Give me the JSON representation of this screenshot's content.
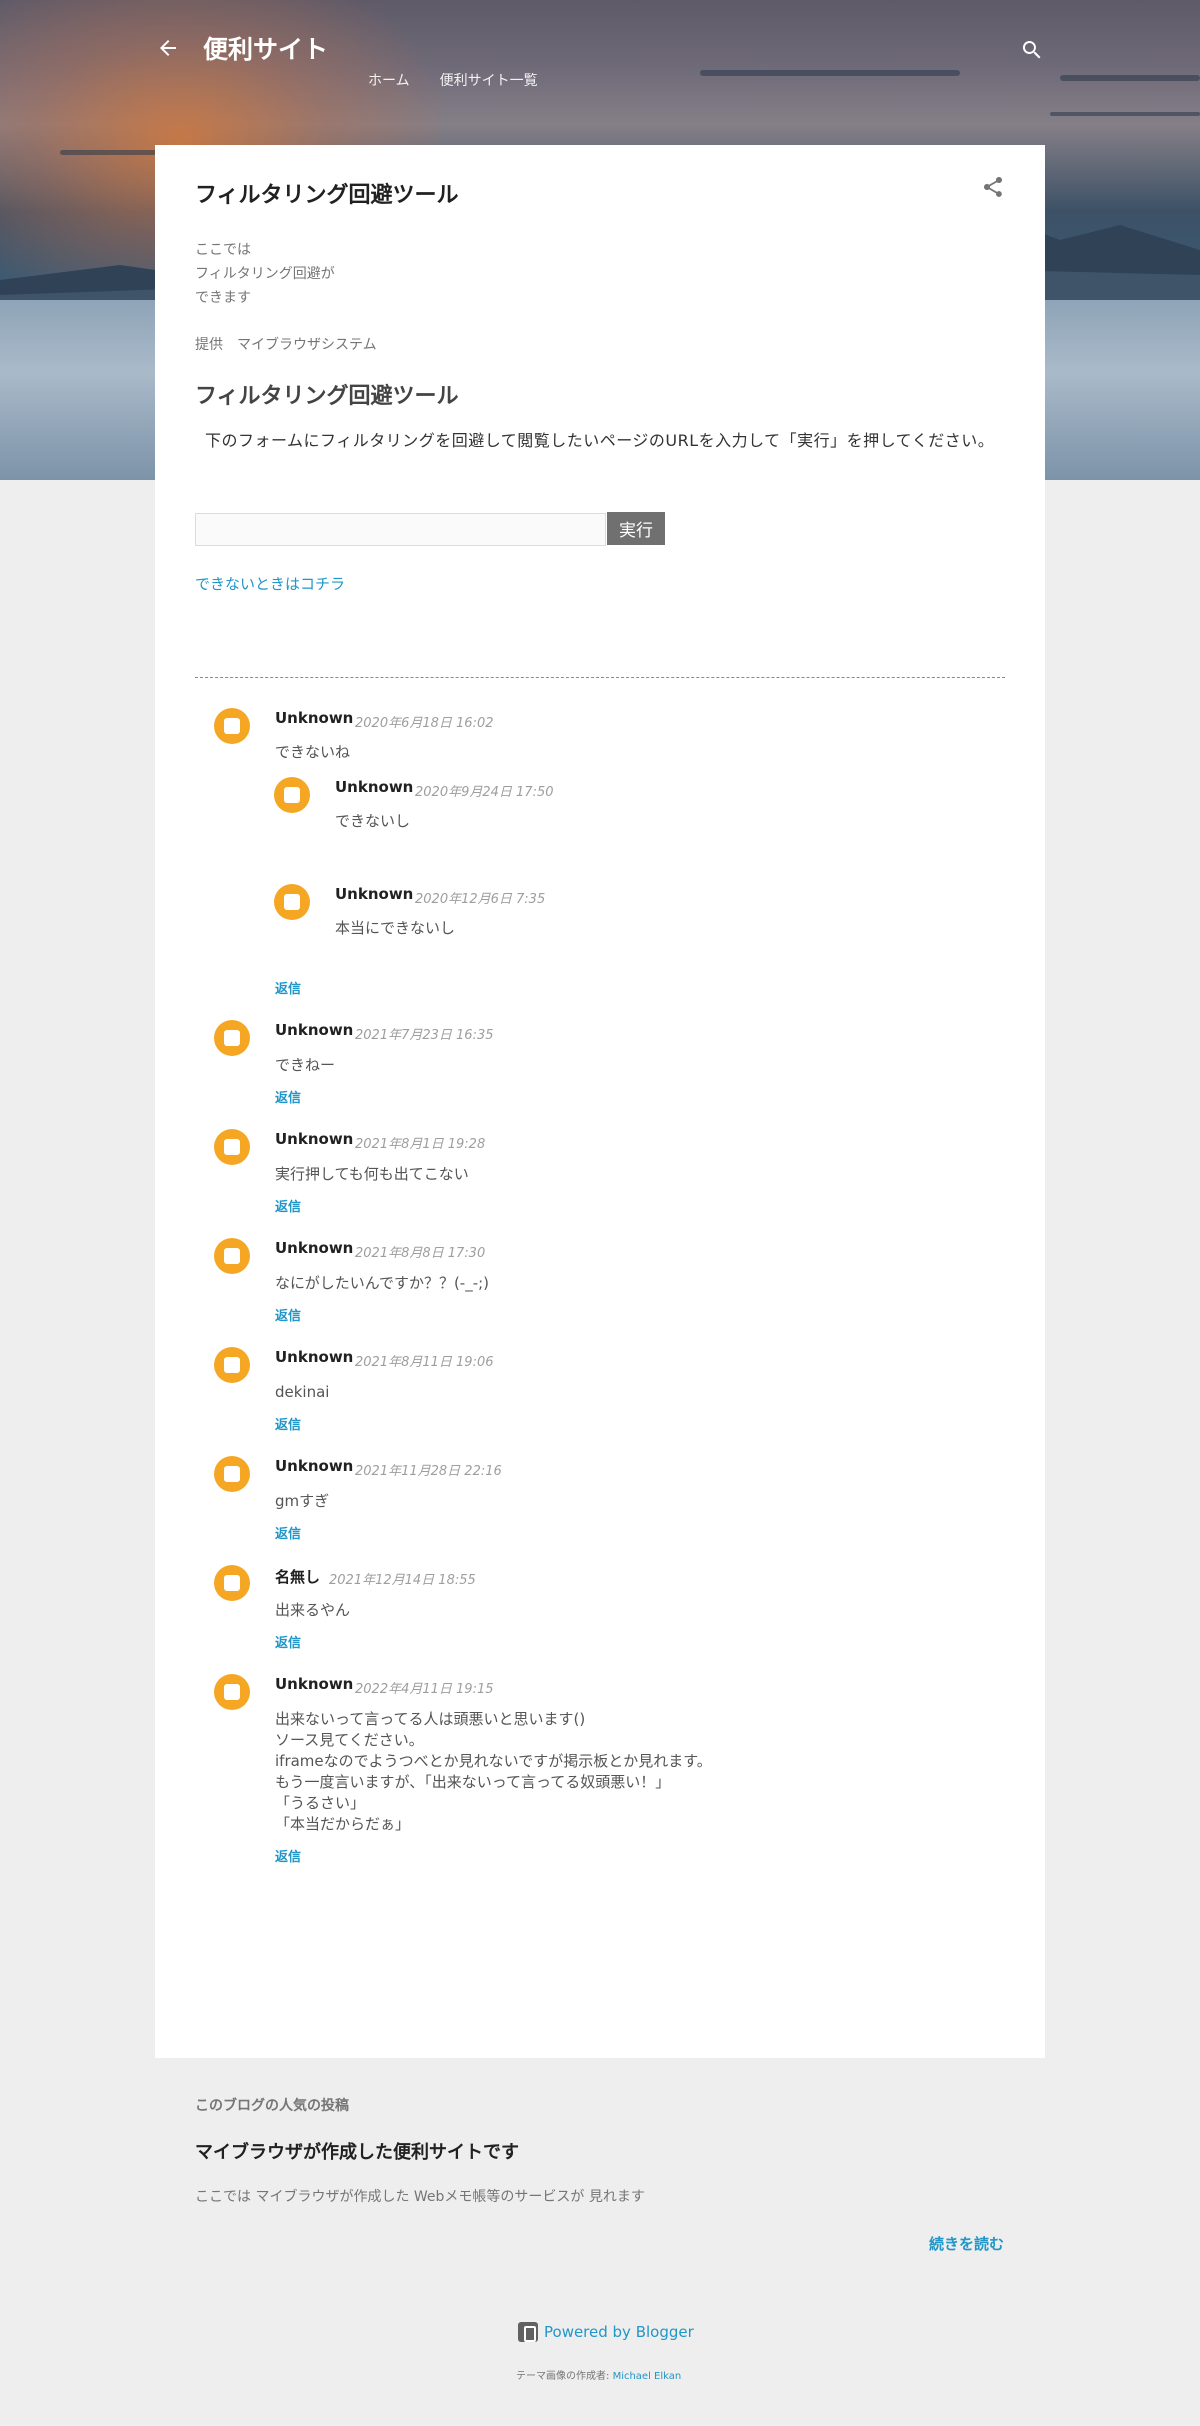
{
  "header": {
    "site_title": "便利サイト",
    "nav": [
      "ホーム",
      "便利サイト一覧"
    ]
  },
  "post": {
    "title": "フィルタリング回避ツール",
    "intro": [
      "ここでは",
      "フィルタリング回避が",
      "できます"
    ],
    "provider": "提供　マイブラウザシステム",
    "tool_heading": "フィルタリング回避ツール",
    "instruction": "下のフォームにフィルタリングを回避して閲覧したいページのURLを入力して「実行」を押してください。",
    "url_input_value": "",
    "run_label": "実行",
    "fallback_link": "できないときはコチラ"
  },
  "comments": [
    {
      "author": "Unknown",
      "date": "2020年6月18日 16:02",
      "body": [
        "できないね"
      ],
      "replies": [
        {
          "author": "Unknown",
          "date": "2020年9月24日 17:50",
          "body": [
            "できないし"
          ]
        },
        {
          "author": "Unknown",
          "date": "2020年12月6日 7:35",
          "body": [
            "本当にできないし"
          ]
        }
      ],
      "reply_label": "返信"
    },
    {
      "author": "Unknown",
      "date": "2021年7月23日 16:35",
      "body": [
        "できねー"
      ],
      "reply_label": "返信"
    },
    {
      "author": "Unknown",
      "date": "2021年8月1日 19:28",
      "body": [
        "実行押しても何も出てこない"
      ],
      "reply_label": "返信"
    },
    {
      "author": "Unknown",
      "date": "2021年8月8日 17:30",
      "body": [
        "なにがしたいんですか？？(-_-;)"
      ],
      "reply_label": "返信"
    },
    {
      "author": "Unknown",
      "date": "2021年8月11日 19:06",
      "body": [
        "dekinai"
      ],
      "reply_label": "返信"
    },
    {
      "author": "Unknown",
      "date": "2021年11月28日 22:16",
      "body": [
        "gmすぎ"
      ],
      "reply_label": "返信"
    },
    {
      "author": "名無し",
      "date": "2021年12月14日 18:55",
      "body": [
        "出来るやん"
      ],
      "reply_label": "返信"
    },
    {
      "author": "Unknown",
      "date": "2022年4月11日 19:15",
      "body": [
        "出来ないって言ってる人は頭悪いと思います()",
        "ソース見てください。",
        "iframeなのでようつべとか見れないですが掲示板とか見れます。",
        "もう一度言いますが、「出来ないって言ってる奴頭悪い！」",
        "「うるさい」",
        "「本当だからだぁ」"
      ],
      "reply_label": "返信"
    }
  ],
  "popular": {
    "label": "このブログの人気の投稿",
    "title": "マイブラウザが作成した便利サイトです",
    "snippet": "ここでは マイブラウザが作成した Webメモ帳等のサービスが 見れます",
    "read_more": "続きを読む"
  },
  "footer": {
    "powered_by": "Powered by Blogger",
    "credit_prefix": "テーマ画像の作成者:",
    "credit_name": "Michael Elkan"
  },
  "colors": {
    "accent": "#2196c8",
    "avatar": "#f5a623",
    "run_button": "#707070"
  },
  "icons": {
    "back": "arrow-back-icon",
    "search": "search-icon",
    "share": "share-icon",
    "avatar": "blogger-avatar-icon",
    "blogger": "blogger-logo-icon"
  }
}
